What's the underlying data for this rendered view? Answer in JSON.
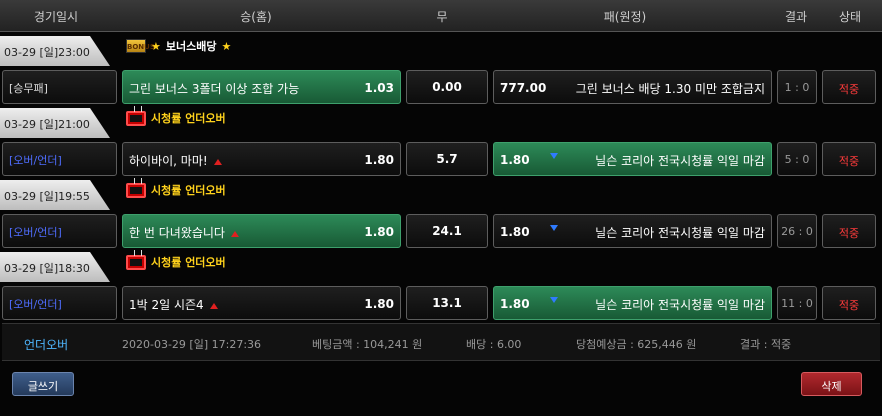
{
  "header": {
    "date": "경기일시",
    "home": "승(홈)",
    "draw": "무",
    "away": "패(원정)",
    "result": "결과",
    "status": "상태"
  },
  "groups": [
    {
      "date": "03-29 [일]23:00",
      "category": "보너스배당",
      "category_icon": "bonus-icon",
      "type": "[승무패]",
      "home_team": "그린 보너스 3폴더 이상 조합 가능",
      "home_odds": "1.03",
      "draw_odds": "0.00",
      "away_odds": "777.00",
      "away_team": "그린 보너스 배당 1.30 미만 조합금지",
      "score": "1 : 0",
      "status": "적중",
      "bet_side": "home"
    },
    {
      "date": "03-29 [일]21:00",
      "category": "시청률 언더오버",
      "category_icon": "tv-icon",
      "type": "[오버/언더]",
      "home_team": "하이바이, 마마!",
      "home_odds": "1.80",
      "draw_odds": "5.7",
      "away_odds": "1.80",
      "away_team": "닐슨 코리아 전국시청률 익일 마감",
      "score": "5 : 0",
      "status": "적중",
      "bet_side": "away"
    },
    {
      "date": "03-29 [일]19:55",
      "category": "시청률 언더오버",
      "category_icon": "tv-icon",
      "type": "[오버/언더]",
      "home_team": "한 번 다녀왔습니다",
      "home_odds": "1.80",
      "draw_odds": "24.1",
      "away_odds": "1.80",
      "away_team": "닐슨 코리아 전국시청률 익일 마감",
      "score": "26 : 0",
      "status": "적중",
      "bet_side": "home"
    },
    {
      "date": "03-29 [일]18:30",
      "category": "시청률 언더오버",
      "category_icon": "tv-icon",
      "type": "[오버/언더]",
      "home_team": "1박 2일 시즌4",
      "home_odds": "1.80",
      "draw_odds": "13.1",
      "away_odds": "1.80",
      "away_team": "닐슨 코리아 전국시청률 익일 마감",
      "score": "11 : 0",
      "status": "적중",
      "bet_side": "away"
    }
  ],
  "summary": {
    "label": "언더오버",
    "datetime": "2020-03-29 [일] 17:27:36",
    "bet_amount": "베팅금액 : 104,241 원",
    "odds": "배당 : 6.00",
    "expected_win": "당첨예상금 : 625,446 원",
    "result": "결과 : 적중"
  },
  "buttons": {
    "write": "글쓰기",
    "delete": "삭제"
  },
  "colors": {
    "selected": "#2d8a58",
    "status_hit": "#ff3b3b",
    "type_blue": "#4f6dff",
    "category_yellow": "#ffd21c"
  }
}
